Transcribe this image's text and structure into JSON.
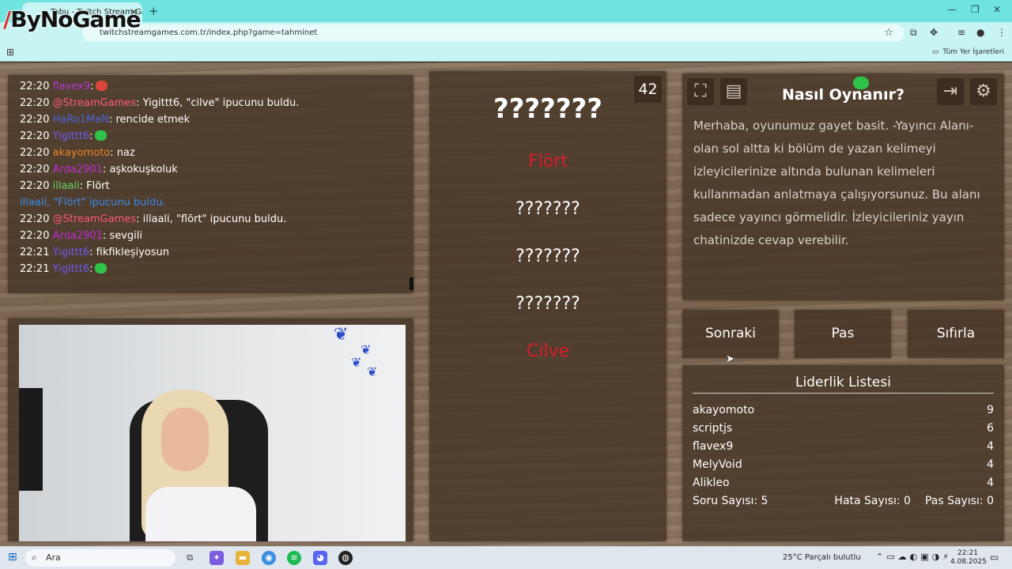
{
  "browser": {
    "tab_title": "Tabu - Twitch Stream Games",
    "url": "twitchstreamgames.com.tr/index.php?game=tahminet",
    "bookmarks_label": "Tüm Yer İşaretleri"
  },
  "logo_text": "ByNoGame",
  "chat": [
    {
      "time": "22:20",
      "user": "flavex9",
      "sep": ":",
      "msg": "",
      "color": "#b93ad6",
      "emote": "#d9453a"
    },
    {
      "time": "22:20",
      "user": "@StreamGames",
      "sep": ":",
      "msg": " Yigittt6, \"cilve\" ipucunu buldu.",
      "color": "#ff5a7a",
      "emote": ""
    },
    {
      "time": "22:20",
      "user": "HaRo1MaN",
      "sep": ":",
      "msg": " rencide etmek",
      "color": "#4a63d8",
      "emote": ""
    },
    {
      "time": "22:20",
      "user": "Yigittt6",
      "sep": ":",
      "msg": "",
      "color": "#6b5cf0",
      "emote": "#2fc34a"
    },
    {
      "time": "22:20",
      "user": "akayomoto",
      "sep": ":",
      "msg": " naz",
      "color": "#f08a2a",
      "emote": ""
    },
    {
      "time": "22:20",
      "user": "Arda2901",
      "sep": ":",
      "msg": " aşkokuşkoluk",
      "color": "#c12fd1",
      "emote": ""
    },
    {
      "time": "22:20",
      "user": "illaali",
      "sep": ":",
      "msg": " Flört",
      "color": "#6ad15a",
      "emote": ""
    },
    {
      "time": "",
      "user": "illaali,",
      "sep": "",
      "msg": " \"Flört\" ipucunu buldu.",
      "color": "#3b8ae6",
      "emote": ""
    },
    {
      "time": "22:20",
      "user": "@StreamGames",
      "sep": ":",
      "msg": " illaali, \"flört\" ipucunu buldu.",
      "color": "#ff5a7a",
      "emote": ""
    },
    {
      "time": "22:20",
      "user": "Arda2901",
      "sep": ":",
      "msg": " sevgili",
      "color": "#c12fd1",
      "emote": ""
    },
    {
      "time": "22:21",
      "user": "Yigittt6",
      "sep": ":",
      "msg": " fikfikleşiyosun",
      "color": "#6b5cf0",
      "emote": ""
    },
    {
      "time": "22:21",
      "user": "Yigittt6",
      "sep": ":",
      "msg": "",
      "color": "#6b5cf0",
      "emote": "#2fc34a"
    }
  ],
  "game": {
    "counter": "42",
    "main_word": "???????",
    "words": [
      {
        "text": "Flört",
        "red": true
      },
      {
        "text": "???????",
        "red": false
      },
      {
        "text": "???????",
        "red": false
      },
      {
        "text": "???????",
        "red": false
      },
      {
        "text": "Cilve",
        "red": true
      }
    ]
  },
  "info": {
    "title": "Nasıl Oynanır?",
    "text": "Merhaba, oyunumuz gayet basit. -Yayıncı Alanı- olan sol altta ki bölüm de yazan kelimeyi izleyicilerinize altında bulunan kelimeleri kullanmadan anlatmaya çalışıyorsunuz. Bu alanı sadece yayıncı görmelidir. İzleyicileriniz yayın chatinizde cevap verebilir."
  },
  "buttons": {
    "next": "Sonraki",
    "pass": "Pas",
    "reset": "Sıfırla"
  },
  "leaderboard": {
    "title": "Liderlik Listesi",
    "rows": [
      {
        "name": "akayomoto",
        "score": "9"
      },
      {
        "name": "scriptjs",
        "score": "6"
      },
      {
        "name": "flavex9",
        "score": "4"
      },
      {
        "name": "MelyVoid",
        "score": "4"
      },
      {
        "name": "Alikleo",
        "score": "4"
      }
    ],
    "questions": "Soru Sayısı: 5",
    "errors": "Hata Sayısı: 0",
    "passes": "Pas Sayısı: 0"
  },
  "taskbar": {
    "search_placeholder": "Ara",
    "weather": "25°C  Parçalı bulutlu",
    "time": "22:21",
    "date": "4.08.2025"
  }
}
